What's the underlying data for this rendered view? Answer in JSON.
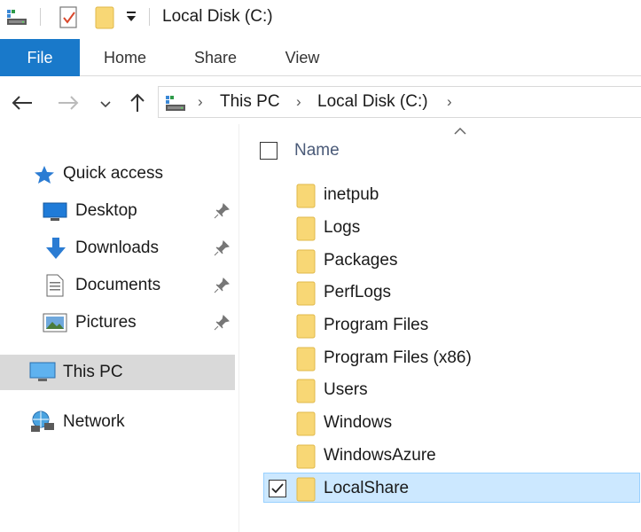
{
  "window": {
    "title": "Local Disk (C:)"
  },
  "ribbon": {
    "tabs": [
      {
        "label": "File",
        "active": true
      },
      {
        "label": "Home"
      },
      {
        "label": "Share"
      },
      {
        "label": "View"
      }
    ]
  },
  "address": {
    "crumbs": [
      "This PC",
      "Local Disk (C:)"
    ]
  },
  "navigation": {
    "quick_access": "Quick access",
    "pinned": [
      {
        "label": "Desktop",
        "icon": "desktop-icon"
      },
      {
        "label": "Downloads",
        "icon": "downloads-icon"
      },
      {
        "label": "Documents",
        "icon": "documents-icon"
      },
      {
        "label": "Pictures",
        "icon": "pictures-icon"
      }
    ],
    "this_pc": "This PC",
    "network": "Network"
  },
  "files": {
    "column_name": "Name",
    "items": [
      {
        "name": "inetpub"
      },
      {
        "name": "Logs"
      },
      {
        "name": "Packages"
      },
      {
        "name": "PerfLogs"
      },
      {
        "name": "Program Files"
      },
      {
        "name": "Program Files (x86)"
      },
      {
        "name": "Users"
      },
      {
        "name": "Windows"
      },
      {
        "name": "WindowsAzure"
      },
      {
        "name": "LocalShare",
        "selected": true
      }
    ]
  },
  "colors": {
    "accent": "#1979ca",
    "selection": "#cce8ff",
    "folder": "#f8d775"
  }
}
